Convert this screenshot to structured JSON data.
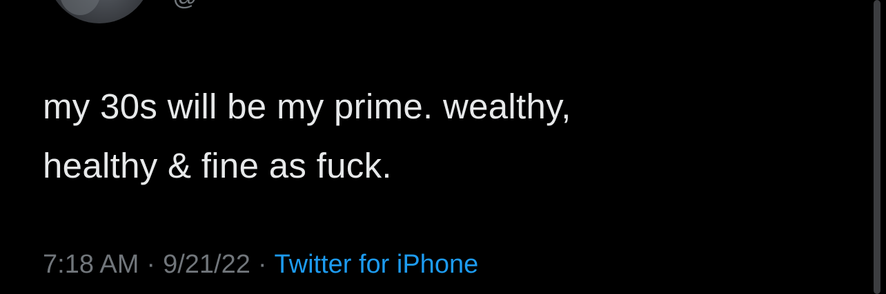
{
  "tweet": {
    "handle": "@",
    "text_line_1": "my 30s will be my prime. wealthy,",
    "text_line_2": "healthy & fine as fuck.",
    "time": "7:18 AM",
    "date": "9/21/22",
    "separator": "·",
    "source": "Twitter for iPhone"
  },
  "colors": {
    "background": "#000000",
    "text": "#e7e9ea",
    "secondary": "#71767b",
    "link": "#1d9bf0"
  }
}
